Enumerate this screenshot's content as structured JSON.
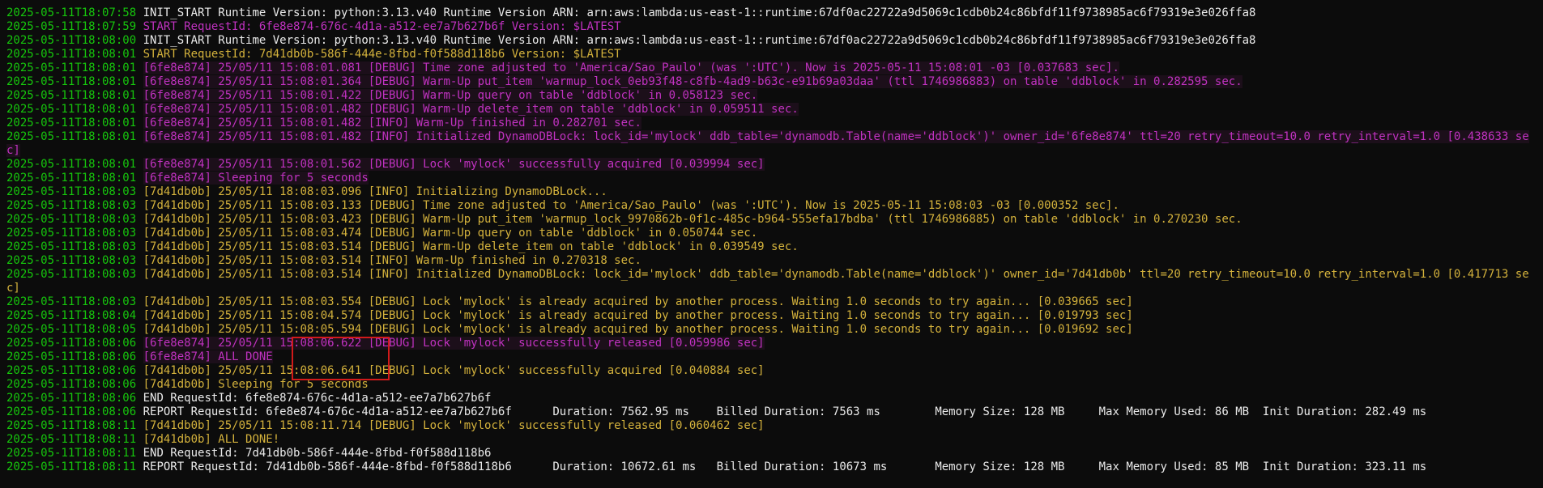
{
  "terminal": {
    "lines": [
      {
        "ts": "2025-05-11T18:07:58",
        "text": "INIT_START Runtime Version: python:3.13.v40 Runtime Version ARN: arn:aws:lambda:us-east-1::runtime:67df0ac22722a9d5069c1cdb0b24c86bfdf11f9738985ac6f79319e3e026ffa8",
        "color": "white"
      },
      {
        "ts": "2025-05-11T18:07:59",
        "text": "START RequestId: 6fe8e874-676c-4d1a-a512-ee7a7b627b6f Version: $LATEST",
        "color": "magenta"
      },
      {
        "ts": "2025-05-11T18:08:00",
        "text": "INIT_START Runtime Version: python:3.13.v40 Runtime Version ARN: arn:aws:lambda:us-east-1::runtime:67df0ac22722a9d5069c1cdb0b24c86bfdf11f9738985ac6f79319e3e026ffa8",
        "color": "white"
      },
      {
        "ts": "2025-05-11T18:08:01",
        "text": "START RequestId: 7d41db0b-586f-444e-8fbd-f0f588d118b6 Version: $LATEST",
        "color": "gold"
      },
      {
        "ts": "2025-05-11T18:08:01",
        "text": "[6fe8e874] 25/05/11 15:08:01.081 [DEBUG] Time zone adjusted to 'America/Sao_Paulo' (was ':UTC'). Now is 2025-05-11 15:08:01 -03 [0.037683 sec].",
        "color": "magenta"
      },
      {
        "ts": "2025-05-11T18:08:01",
        "text": "[6fe8e874] 25/05/11 15:08:01.364 [DEBUG] Warm-Up put_item 'warmup_lock_0eb93f48-c8fb-4ad9-b63c-e91b69a03daa' (ttl 1746986883) on table 'ddblock' in 0.282595 sec.",
        "color": "magenta"
      },
      {
        "ts": "2025-05-11T18:08:01",
        "text": "[6fe8e874] 25/05/11 15:08:01.422 [DEBUG] Warm-Up query on table 'ddblock' in 0.058123 sec.",
        "color": "magenta"
      },
      {
        "ts": "2025-05-11T18:08:01",
        "text": "[6fe8e874] 25/05/11 15:08:01.482 [DEBUG] Warm-Up delete_item on table 'ddblock' in 0.059511 sec.",
        "color": "magenta"
      },
      {
        "ts": "2025-05-11T18:08:01",
        "text": "[6fe8e874] 25/05/11 15:08:01.482 [INFO] Warm-Up finished in 0.282701 sec.",
        "color": "magenta"
      },
      {
        "ts": "2025-05-11T18:08:01",
        "text": "[6fe8e874] 25/05/11 15:08:01.482 [INFO] Initialized DynamoDBLock: lock_id='mylock' ddb_table='dynamodb.Table(name='ddblock')' owner_id='6fe8e874' ttl=20 retry_timeout=10.0 retry_interval=1.0 [0.438633 sec]",
        "color": "magenta",
        "wrap": true
      },
      {
        "ts": "2025-05-11T18:08:01",
        "text": "[6fe8e874] 25/05/11 15:08:01.562 [DEBUG] Lock 'mylock' successfully acquired [0.039994 sec]",
        "color": "magenta"
      },
      {
        "ts": "2025-05-11T18:08:01",
        "text": "[6fe8e874] Sleeping for 5 seconds",
        "color": "magenta"
      },
      {
        "ts": "2025-05-11T18:08:03",
        "text": "[7d41db0b] 25/05/11 18:08:03.096 [INFO] Initializing DynamoDBLock...",
        "color": "gold"
      },
      {
        "ts": "2025-05-11T18:08:03",
        "text": "[7d41db0b] 25/05/11 15:08:03.133 [DEBUG] Time zone adjusted to 'America/Sao_Paulo' (was ':UTC'). Now is 2025-05-11 15:08:03 -03 [0.000352 sec].",
        "color": "gold"
      },
      {
        "ts": "2025-05-11T18:08:03",
        "text": "[7d41db0b] 25/05/11 15:08:03.423 [DEBUG] Warm-Up put_item 'warmup_lock_9970862b-0f1c-485c-b964-555efa17bdba' (ttl 1746986885) on table 'ddblock' in 0.270230 sec.",
        "color": "gold"
      },
      {
        "ts": "2025-05-11T18:08:03",
        "text": "[7d41db0b] 25/05/11 15:08:03.474 [DEBUG] Warm-Up query on table 'ddblock' in 0.050744 sec.",
        "color": "gold"
      },
      {
        "ts": "2025-05-11T18:08:03",
        "text": "[7d41db0b] 25/05/11 15:08:03.514 [DEBUG] Warm-Up delete_item on table 'ddblock' in 0.039549 sec.",
        "color": "gold"
      },
      {
        "ts": "2025-05-11T18:08:03",
        "text": "[7d41db0b] 25/05/11 15:08:03.514 [INFO] Warm-Up finished in 0.270318 sec.",
        "color": "gold"
      },
      {
        "ts": "2025-05-11T18:08:03",
        "text": "[7d41db0b] 25/05/11 15:08:03.514 [INFO] Initialized DynamoDBLock: lock_id='mylock' ddb_table='dynamodb.Table(name='ddblock')' owner_id='7d41db0b' ttl=20 retry_timeout=10.0 retry_interval=1.0 [0.417713 sec]",
        "color": "gold",
        "wrap": true
      },
      {
        "ts": "2025-05-11T18:08:03",
        "text": "[7d41db0b] 25/05/11 15:08:03.554 [DEBUG] Lock 'mylock' is already acquired by another process. Waiting 1.0 seconds to try again... [0.039665 sec]",
        "color": "gold"
      },
      {
        "ts": "2025-05-11T18:08:04",
        "text": "[7d41db0b] 25/05/11 15:08:04.574 [DEBUG] Lock 'mylock' is already acquired by another process. Waiting 1.0 seconds to try again... [0.019793 sec]",
        "color": "gold"
      },
      {
        "ts": "2025-05-11T18:08:05",
        "text": "[7d41db0b] 25/05/11 15:08:05.594 [DEBUG] Lock 'mylock' is already acquired by another process. Waiting 1.0 seconds to try again... [0.019692 sec]",
        "color": "gold"
      },
      {
        "ts": "2025-05-11T18:08:06",
        "text": "[6fe8e874] 25/05/11 15:08:06.622 [DEBUG] Lock 'mylock' successfully released [0.059986 sec]",
        "color": "magenta"
      },
      {
        "ts": "2025-05-11T18:08:06",
        "text": "[6fe8e874] ALL DONE",
        "color": "magenta"
      },
      {
        "ts": "2025-05-11T18:08:06",
        "text": "[7d41db0b] 25/05/11 15:08:06.641 [DEBUG] Lock 'mylock' successfully acquired [0.040884 sec]",
        "color": "gold"
      },
      {
        "ts": "2025-05-11T18:08:06",
        "text": "[7d41db0b] Sleeping for 5 seconds",
        "color": "gold"
      },
      {
        "ts": "2025-05-11T18:08:06",
        "text": "END RequestId: 6fe8e874-676c-4d1a-a512-ee7a7b627b6f",
        "color": "white"
      },
      {
        "ts": "2025-05-11T18:08:06",
        "text": "REPORT RequestId: 6fe8e874-676c-4d1a-a512-ee7a7b627b6f      Duration: 7562.95 ms    Billed Duration: 7563 ms        Memory Size: 128 MB     Max Memory Used: 86 MB  Init Duration: 282.49 ms",
        "color": "white"
      },
      {
        "ts": "2025-05-11T18:08:11",
        "text": "[7d41db0b] 25/05/11 15:08:11.714 [DEBUG] Lock 'mylock' successfully released [0.060462 sec]",
        "color": "gold"
      },
      {
        "ts": "2025-05-11T18:08:11",
        "text": "[7d41db0b] ALL DONE!",
        "color": "gold"
      },
      {
        "ts": "2025-05-11T18:08:11",
        "text": "END RequestId: 7d41db0b-586f-444e-8fbd-f0f588d118b6",
        "color": "white"
      },
      {
        "ts": "2025-05-11T18:08:11",
        "text": "REPORT RequestId: 7d41db0b-586f-444e-8fbd-f0f588d118b6      Duration: 10672.61 ms   Billed Duration: 10673 ms       Memory Size: 128 MB     Max Memory Used: 85 MB  Init Duration: 323.11 ms",
        "color": "white"
      }
    ]
  },
  "colors": {
    "background": "#0c0c0c",
    "timestamp": "#16c60c",
    "white": "#eaeaea",
    "magenta": "#c032c0",
    "gold": "#d4b23c",
    "highlight_box": "#d11a1a"
  }
}
